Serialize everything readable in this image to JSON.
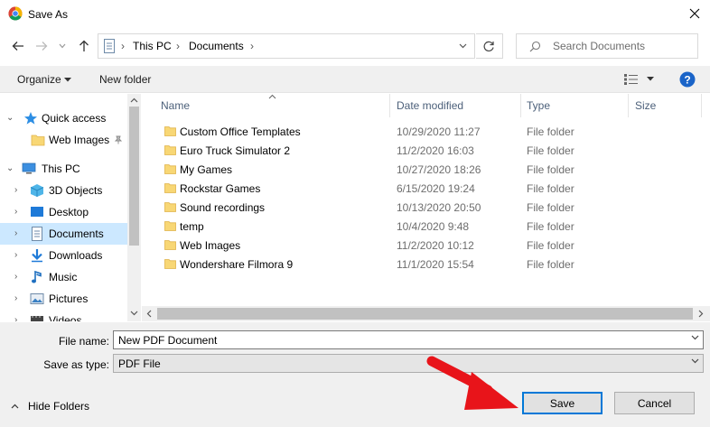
{
  "window": {
    "title": "Save As"
  },
  "address": {
    "crumbs": [
      "This PC",
      "Documents"
    ],
    "search_placeholder": "Search Documents"
  },
  "toolbar": {
    "organize_label": "Organize",
    "new_folder_label": "New folder"
  },
  "nav": {
    "items": [
      {
        "label": "Quick access",
        "icon": "star-icon"
      },
      {
        "label": "Web Images",
        "icon": "folder-icon",
        "pinned": true
      },
      {
        "label": "This PC",
        "icon": "computer-icon"
      },
      {
        "label": "3D Objects",
        "icon": "cube-icon"
      },
      {
        "label": "Desktop",
        "icon": "desktop-icon"
      },
      {
        "label": "Documents",
        "icon": "documents-icon",
        "selected": true
      },
      {
        "label": "Downloads",
        "icon": "download-icon"
      },
      {
        "label": "Music",
        "icon": "music-icon"
      },
      {
        "label": "Pictures",
        "icon": "pictures-icon"
      },
      {
        "label": "Videos",
        "icon": "video-icon"
      }
    ]
  },
  "filelist": {
    "columns": [
      "Name",
      "Date modified",
      "Type",
      "Size"
    ],
    "rows": [
      {
        "name": "Custom Office Templates",
        "date": "10/29/2020 11:27",
        "type": "File folder"
      },
      {
        "name": "Euro Truck Simulator 2",
        "date": "11/2/2020 16:03",
        "type": "File folder"
      },
      {
        "name": "My Games",
        "date": "10/27/2020 18:26",
        "type": "File folder"
      },
      {
        "name": "Rockstar Games",
        "date": "6/15/2020 19:24",
        "type": "File folder"
      },
      {
        "name": "Sound recordings",
        "date": "10/13/2020 20:50",
        "type": "File folder"
      },
      {
        "name": "temp",
        "date": "10/4/2020 9:48",
        "type": "File folder"
      },
      {
        "name": "Web Images",
        "date": "11/2/2020 10:12",
        "type": "File folder"
      },
      {
        "name": "Wondershare Filmora 9",
        "date": "11/1/2020 15:54",
        "type": "File folder"
      }
    ]
  },
  "form": {
    "file_name_label": "File name:",
    "file_name_value": "New PDF Document",
    "save_type_label": "Save as type:",
    "save_type_value": "PDF File"
  },
  "buttons": {
    "hide_folders": "Hide Folders",
    "save": "Save",
    "cancel": "Cancel"
  },
  "colors": {
    "accent": "#0078d7",
    "selection": "#cce8ff",
    "folder": "#f8d775",
    "annotation_arrow": "#e8141a"
  }
}
